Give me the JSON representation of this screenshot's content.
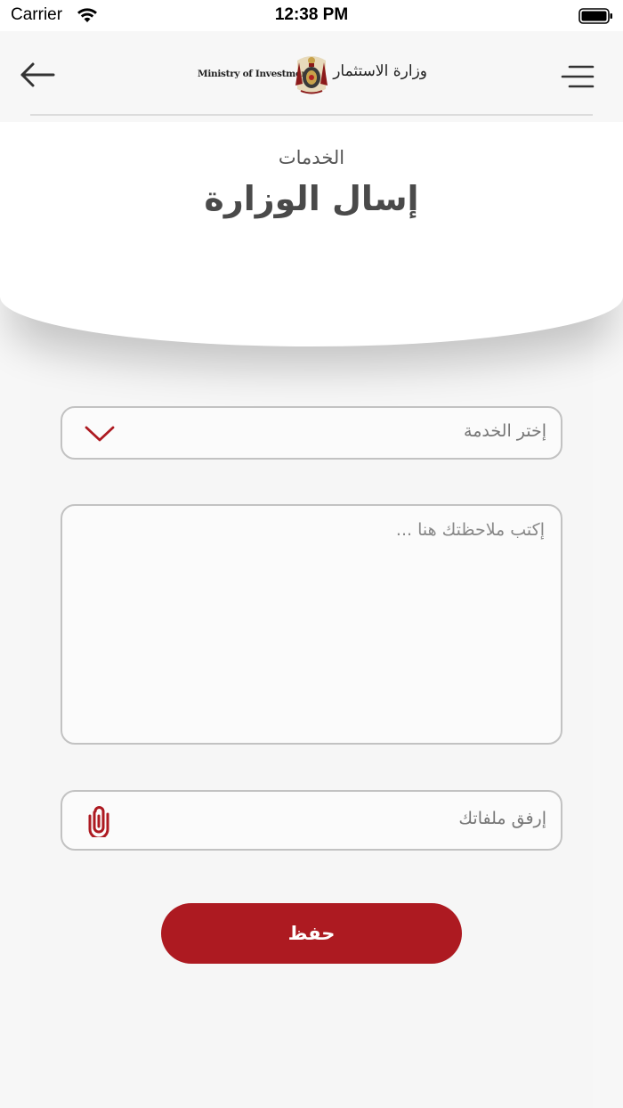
{
  "status_bar": {
    "carrier": "Carrier",
    "time": "12:38 PM"
  },
  "nav": {
    "logo_en": "Ministry of Investment",
    "logo_ar": "وزارة الاستثمار",
    "back_icon": "arrow-left-icon",
    "menu_icon": "menu-icon"
  },
  "header": {
    "subtitle": "الخدمات",
    "title": "إسال الوزارة"
  },
  "form": {
    "service_select_label": "إختر الخدمة",
    "notes_placeholder": "إكتب ملاحظتك هنا ...",
    "attach_label": "إرفق ملفاتك",
    "save_label": "حفظ"
  },
  "colors": {
    "accent": "#ad1a21",
    "field_border": "#c2c2c2",
    "background": "#f7f7f7"
  }
}
